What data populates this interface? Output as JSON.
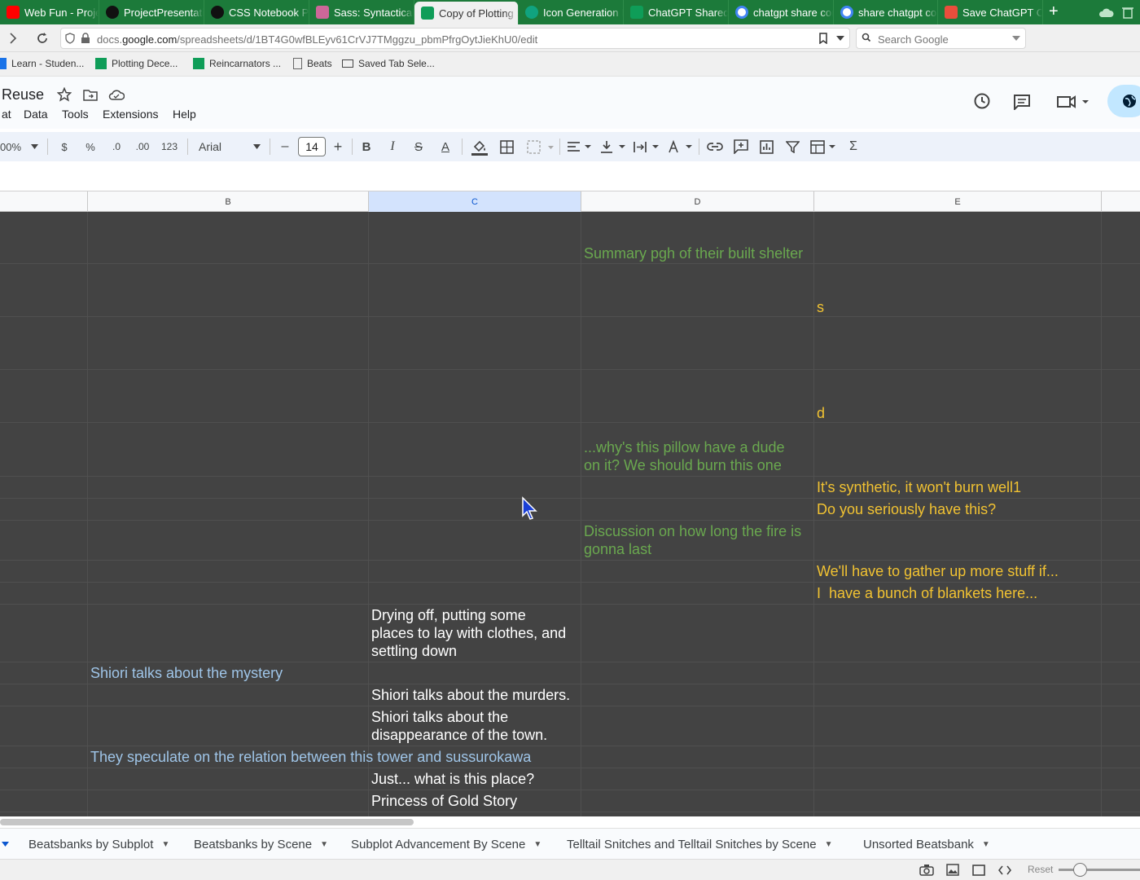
{
  "browser": {
    "tabs": [
      {
        "title": "Web Fun - Project",
        "favicon": "youtube-icon",
        "color": "#ff0000",
        "active": false
      },
      {
        "title": "ProjectPresentatio",
        "favicon": "github-icon",
        "color": "#111111",
        "active": false
      },
      {
        "title": "CSS Notebook Pa",
        "favicon": "codepen-icon",
        "color": "#111111",
        "active": false
      },
      {
        "title": "Sass: Syntactically",
        "favicon": "sass-icon",
        "color": "#cd6799",
        "active": false
      },
      {
        "title": "Copy of Plotting S",
        "favicon": "sheets-icon",
        "color": "#0f9d58",
        "active": true
      },
      {
        "title": "Icon Generation Is",
        "favicon": "openai-icon",
        "color": "#10a37f",
        "active": false
      },
      {
        "title": "ChatGPT Shared L",
        "favicon": "sheets-icon",
        "color": "#0f9d58",
        "active": false
      },
      {
        "title": "chatgpt share con",
        "favicon": "google-icon",
        "color": "#4285f4",
        "active": false
      },
      {
        "title": "share chatgpt con",
        "favicon": "google-icon",
        "color": "#4285f4",
        "active": false
      },
      {
        "title": "Save ChatGPT Co",
        "favicon": "extension-icon",
        "color": "#e94e3c",
        "active": false
      }
    ],
    "new_tab_label": "+",
    "url_prefix": "docs.",
    "url_host": "google.com",
    "url_path": "/spreadsheets/d/1BT4G0wfBLEyv61CrVJ7TMggzu_pbmPfrgOytJieKhU0/edit",
    "search_placeholder": "Search Google"
  },
  "bookmarks": [
    {
      "label": "Learn - Studen...",
      "icon": "learn-icon"
    },
    {
      "label": "Plotting Dece...",
      "icon": "sheets-icon"
    },
    {
      "label": "Reincarnators ...",
      "icon": "sheets-icon"
    },
    {
      "label": "Beats",
      "icon": "doc-icon"
    },
    {
      "label": "Saved Tab Sele...",
      "icon": "folder-icon"
    }
  ],
  "doc": {
    "title": "Reuse",
    "menu": [
      "at",
      "Data",
      "Tools",
      "Extensions",
      "Help"
    ]
  },
  "toolbar": {
    "zoom": "00%",
    "currency": "$",
    "percent": "%",
    "dec_decrease": ".0",
    "dec_increase": ".00",
    "number_format": "123",
    "font": "Arial",
    "font_size": "14",
    "minus": "–",
    "plus": "+",
    "bold": "B",
    "italic": "I",
    "strike": "S",
    "text_color": "A",
    "sum": "Σ"
  },
  "columns": [
    {
      "label": "B",
      "selected": false
    },
    {
      "label": "C",
      "selected": true
    },
    {
      "label": "D",
      "selected": false
    },
    {
      "label": "E",
      "selected": false
    }
  ],
  "cells": {
    "d_summary": "Summary pgh of their built shelter",
    "e_s": "s",
    "e_d": "d",
    "d_pillow": "...why's this pillow have a dude\non it? We should burn this one",
    "e_synthetic": "It's synthetic, it won't burn well1",
    "e_seriously": "Do you seriously have this?",
    "d_discussion": "Discussion on how long the fire is\ngonna last",
    "e_gather": "We'll have to gather up more stuff if...",
    "e_blankets": "I  have a bunch of blankets here...",
    "c_drying": "Drying off, putting some\nplaces to lay with clothes, and\nsettling down",
    "b_mystery": "Shiori talks about the mystery",
    "c_murders": "Shiori talks about the murders.",
    "c_disappearance": "Shiori talks about the\ndisappearance of the town.",
    "b_speculate": "They speculate on the relation between this tower and sussurokawa",
    "c_place": "Just... what is this place?",
    "c_princess": "Princess of Gold Story"
  },
  "sheets": [
    "Beatsbanks by Subplot",
    "Beatsbanks by Scene",
    "Subplot Advancement By Scene",
    "Telltail Snitches and Telltail Snitches by Scene",
    "Unsorted Beatsbank"
  ],
  "status": {
    "reset_label": "Reset"
  },
  "colors": {
    "grid_bg": "#434343",
    "green_text": "#6aa84f",
    "orange_text": "#f1c232",
    "blue_text": "#9fc5e8",
    "tabstrip": "#1c7a3a"
  }
}
